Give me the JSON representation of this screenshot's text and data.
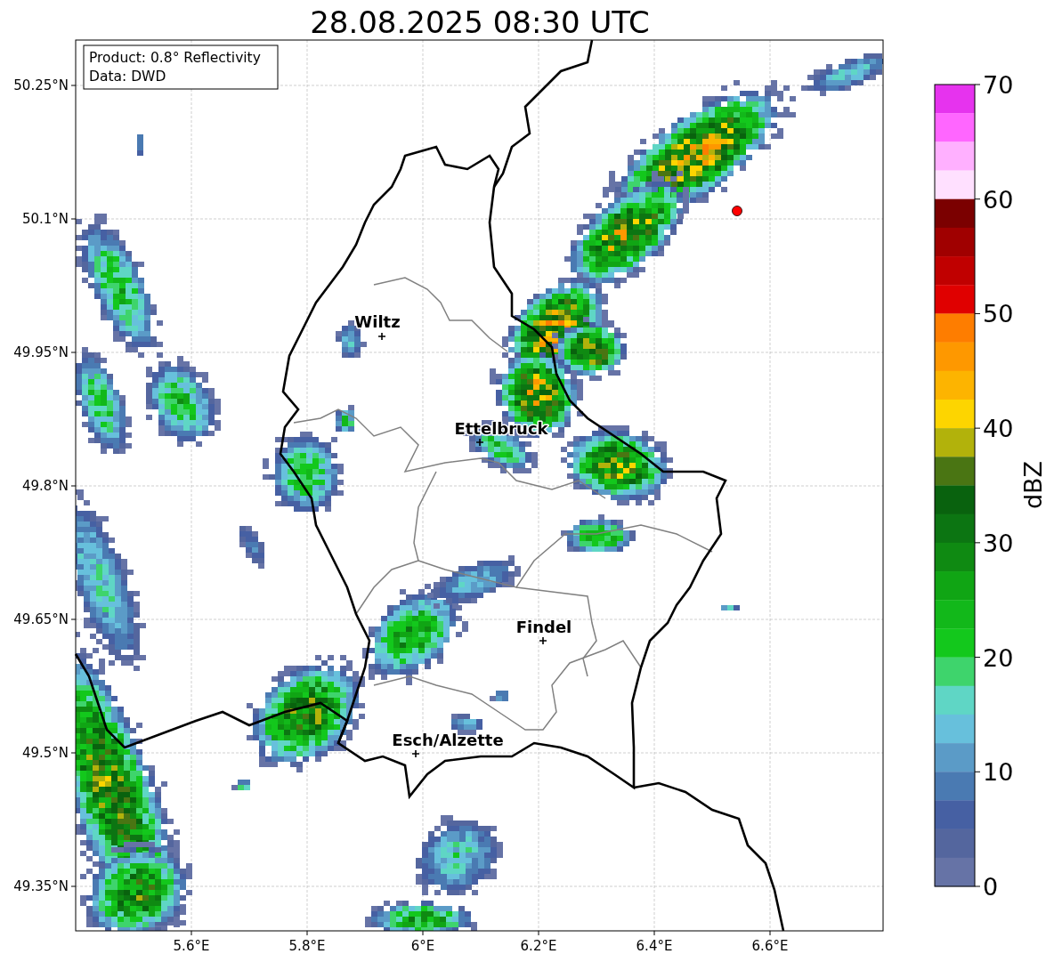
{
  "title": "28.08.2025 08:30 UTC",
  "info_box": [
    "Product: 0.8° Reflectivity",
    "Data: DWD"
  ],
  "map": {
    "x_tick_labels": [
      "5.6°E",
      "5.8°E",
      "6°E",
      "6.2°E",
      "6.4°E",
      "6.6°E"
    ],
    "y_tick_labels": [
      "50.25°N",
      "50.1°N",
      "49.95°N",
      "49.8°N",
      "49.65°N",
      "49.5°N",
      "49.35°N"
    ],
    "cities": [
      {
        "name": "Wiltz"
      },
      {
        "name": "Ettelbruck"
      },
      {
        "name": "Findel"
      },
      {
        "name": "Esch/Alzette"
      }
    ]
  },
  "colorbar": {
    "label": "dBZ",
    "tick_labels": [
      "70",
      "60",
      "50",
      "40",
      "30",
      "20",
      "10",
      "0"
    ],
    "levels": [
      {
        "color": "#e633ee"
      },
      {
        "color": "#ff66ff"
      },
      {
        "color": "#ffb0ff"
      },
      {
        "color": "#ffe0ff"
      },
      {
        "color": "#7b0000"
      },
      {
        "color": "#a00000"
      },
      {
        "color": "#c00000"
      },
      {
        "color": "#e00000"
      },
      {
        "color": "#fe7d00"
      },
      {
        "color": "#fe9800"
      },
      {
        "color": "#fdb400"
      },
      {
        "color": "#fdd500"
      },
      {
        "color": "#b2b20b"
      },
      {
        "color": "#4a7513"
      },
      {
        "color": "#09620e"
      },
      {
        "color": "#0c7512"
      },
      {
        "color": "#0f8a12"
      },
      {
        "color": "#10a514"
      },
      {
        "color": "#12b81a"
      },
      {
        "color": "#13c81c"
      },
      {
        "color": "#3ed46c"
      },
      {
        "color": "#5fd6c5"
      },
      {
        "color": "#67c0dc"
      },
      {
        "color": "#5b9bc7"
      },
      {
        "color": "#4a7ab2"
      },
      {
        "color": "#4660a3"
      },
      {
        "color": "#54669e"
      },
      {
        "color": "#6673a6"
      }
    ]
  }
}
